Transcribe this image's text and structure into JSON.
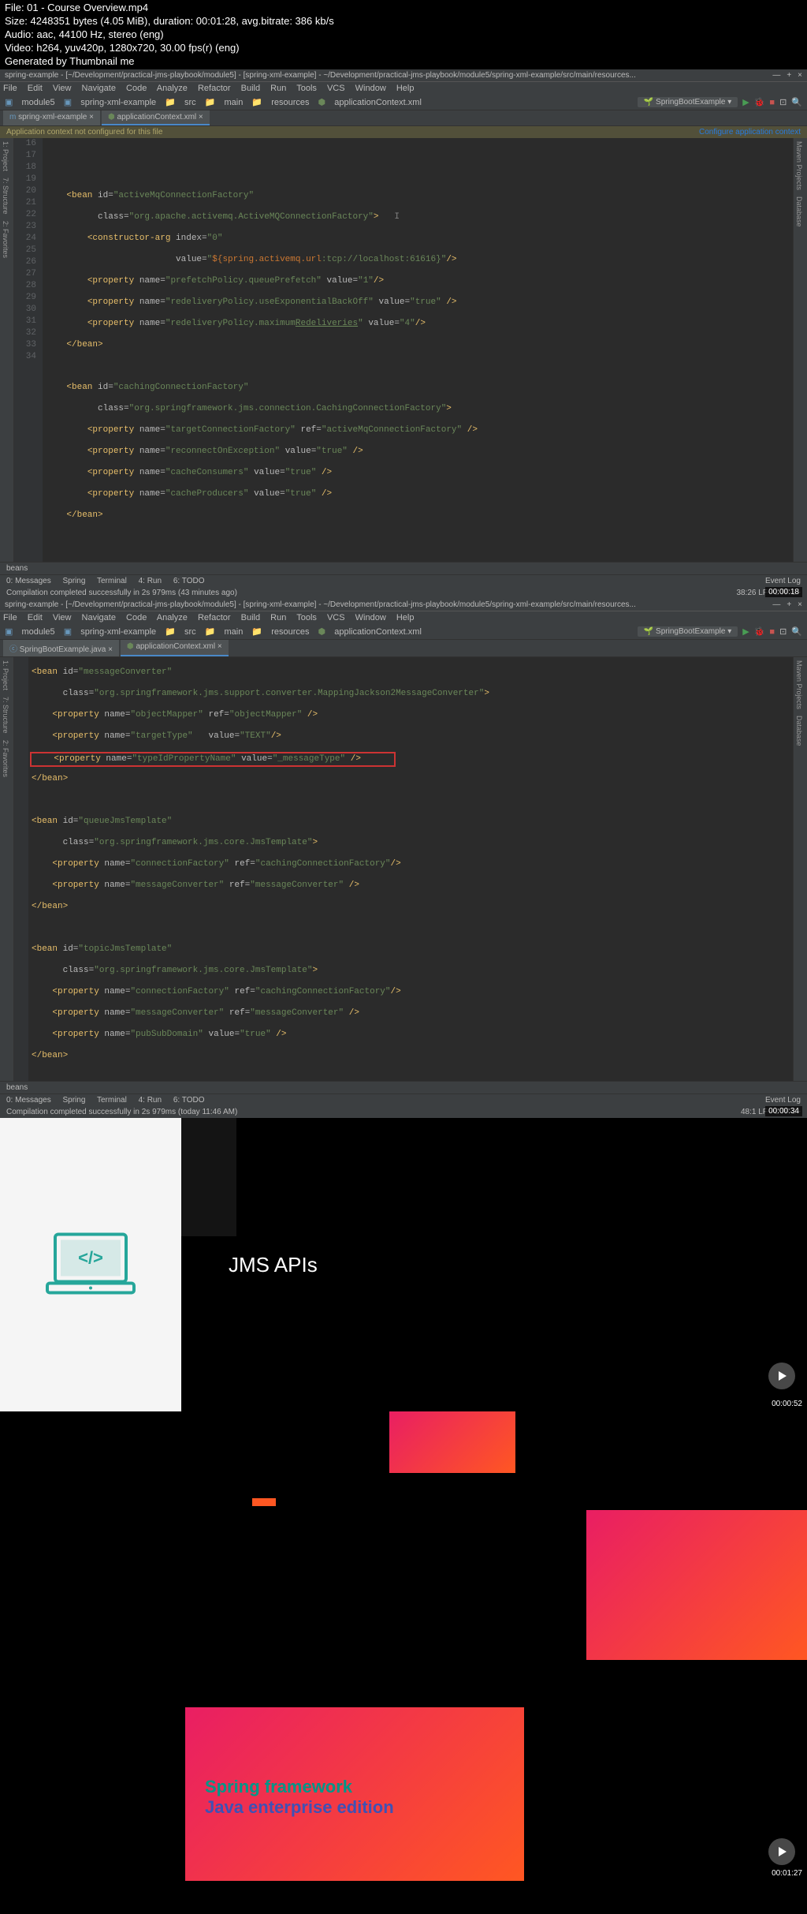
{
  "file_info": {
    "file": "File: 01 - Course Overview.mp4",
    "size": "Size: 4248351 bytes (4.05 MiB), duration: 00:01:28, avg.bitrate: 386 kb/s",
    "audio": "Audio: aac, 44100 Hz, stereo (eng)",
    "video": "Video: h264, yuv420p, 1280x720, 30.00 fps(r) (eng)",
    "gen": "Generated by Thumbnail me"
  },
  "ide1": {
    "title": "spring-example - [~/Development/practical-jms-playbook/module5] - [spring-xml-example] - ~/Development/practical-jms-playbook/module5/spring-xml-example/src/main/resources...",
    "menu": [
      "File",
      "Edit",
      "View",
      "Navigate",
      "Code",
      "Analyze",
      "Refactor",
      "Build",
      "Run",
      "Tools",
      "VCS",
      "Window",
      "Help"
    ],
    "breadcrumb": {
      "module": "module5",
      "proj": "spring-xml-example",
      "src": "src",
      "main": "main",
      "res": "resources",
      "file": "applicationContext.xml"
    },
    "run_config": "SpringBootExample",
    "tabs": [
      {
        "name": "spring-xml-example",
        "active": false
      },
      {
        "name": "applicationContext.xml",
        "active": true
      }
    ],
    "warning": "Application context not configured for this file",
    "warning_link": "Configure application context",
    "line_nums": [
      "16",
      "17",
      "18",
      "19",
      "20",
      "21",
      "22",
      "23",
      "24",
      "25",
      "26",
      "27",
      "28",
      "29",
      "30",
      "31",
      "32",
      "33",
      "34"
    ],
    "footer": "beans",
    "status": {
      "messages": "0: Messages",
      "spring": "Spring",
      "terminal": "Terminal",
      "run": "4: Run",
      "todo": "6: TODO",
      "event": "Event Log"
    },
    "compile": "Compilation completed successfully in 2s 979ms (43 minutes ago)",
    "pos": "38:26  LF÷  UTF-8÷",
    "ts": "00:00:18"
  },
  "ide2": {
    "title": "spring-example - [~/Development/practical-jms-playbook/module5] - [spring-xml-example] - ~/Development/practical-jms-playbook/module5/spring-xml-example/src/main/resources...",
    "tabs": [
      {
        "name": "SpringBootExample.java",
        "active": false
      },
      {
        "name": "applicationContext.xml",
        "active": true
      }
    ],
    "compile": "Compilation completed successfully in 2s 979ms (today 11:46 AM)",
    "pos": "48:1  LF÷  UTF-8÷",
    "ts": "00:00:34"
  },
  "slide3": {
    "title": "JMS APIs",
    "ts": "00:00:52"
  },
  "slide4": {
    "text1": "Spring framework",
    "text2": "Java enterprise edition",
    "ts": "00:01:27"
  }
}
